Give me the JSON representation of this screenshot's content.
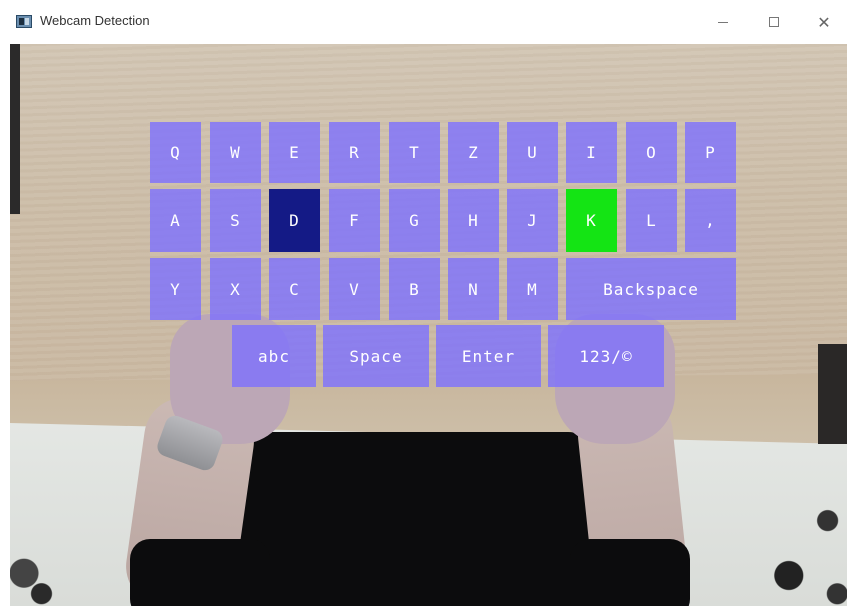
{
  "window": {
    "title": "Webcam Detection",
    "minimize_glyph": "",
    "maximize_glyph": "",
    "close_glyph": "✕"
  },
  "keyboard": {
    "colors": {
      "key": "#7d70ff",
      "hover": "#141a86",
      "pressed": "#14e414",
      "text": "#ffffff"
    },
    "row1": [
      "Q",
      "W",
      "E",
      "R",
      "T",
      "Z",
      "U",
      "I",
      "O",
      "P"
    ],
    "row2": [
      "A",
      "S",
      "D",
      "F",
      "G",
      "H",
      "J",
      "K",
      "L",
      ","
    ],
    "row3": [
      "Y",
      "X",
      "C",
      "V",
      "B",
      "N",
      "M",
      "Backspace"
    ],
    "row4": [
      "abc",
      "Space",
      "Enter",
      "123/©"
    ],
    "hover_key": "D",
    "pressed_key": "K"
  }
}
